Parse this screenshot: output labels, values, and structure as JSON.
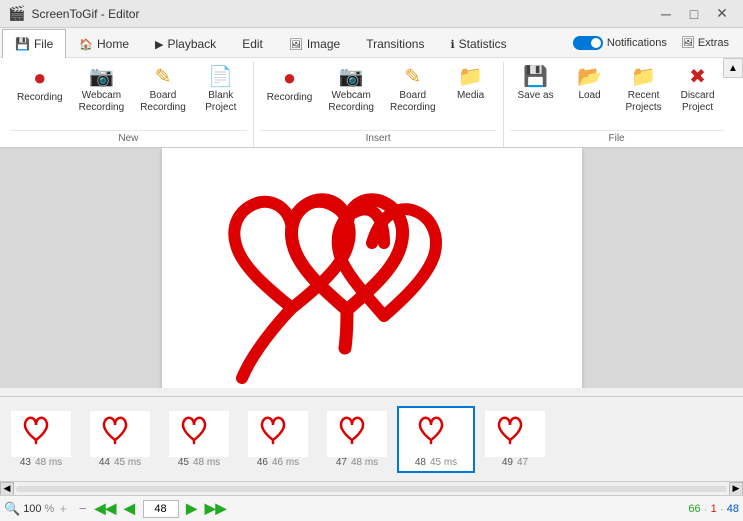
{
  "app": {
    "title": "ScreenToGif - Editor",
    "icon": "gif"
  },
  "titlebar": {
    "title": "ScreenToGif - Editor",
    "minimize": "─",
    "maximize": "□",
    "close": "✕"
  },
  "menutabs": {
    "file": "File",
    "home": "Home",
    "playback": "Playback",
    "edit": "Edit",
    "image": "Image",
    "transitions": "Transitions",
    "statistics": "Statistics"
  },
  "notifications": {
    "label": "Notifications",
    "extras": "Extras"
  },
  "ribbon": {
    "new_group": "New",
    "insert_group": "Insert",
    "file_group": "File",
    "buttons": {
      "recording": "Recording",
      "webcam_recording": "Webcam\nRecording",
      "board_recording": "Board\nRecording",
      "blank_project": "Blank\nProject",
      "insert_recording": "Recording",
      "insert_webcam": "Webcam\nRecording",
      "insert_board": "Board\nRecording",
      "media": "Media",
      "save_as": "Save as",
      "load": "Load",
      "recent_projects": "Recent\nProjects",
      "discard_project": "Discard\nProject"
    }
  },
  "filmstrip": {
    "frames": [
      {
        "num": "43",
        "ms": "48 ms"
      },
      {
        "num": "44",
        "ms": "45 ms"
      },
      {
        "num": "45",
        "ms": "48 ms"
      },
      {
        "num": "46",
        "ms": "46 ms"
      },
      {
        "num": "47",
        "ms": "48 ms"
      },
      {
        "num": "48",
        "ms": "45 ms",
        "active": true
      },
      {
        "num": "49",
        "ms": "47"
      }
    ]
  },
  "bottombar": {
    "zoom": "100",
    "zoom_symbol": "%",
    "coord_x": "66",
    "coord_y": "1",
    "coord_z": "48",
    "nav_prev_green": "◀",
    "nav_next_green": "▶",
    "nav_prev_blue": "◀",
    "nav_next_blue": "▶",
    "zoom_icon": "🔍"
  }
}
